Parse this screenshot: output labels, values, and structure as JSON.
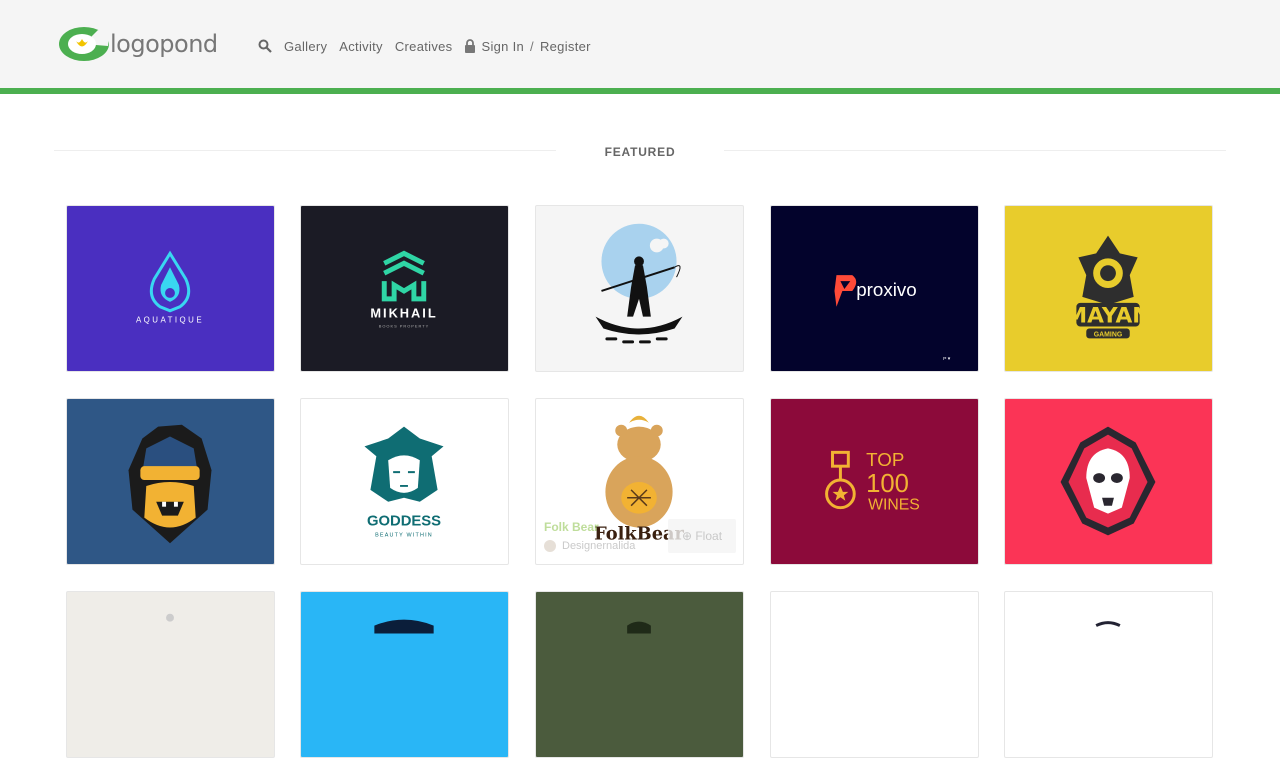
{
  "header": {
    "logo_text": "logopond",
    "nav": {
      "gallery": "Gallery",
      "activity": "Activity",
      "creatives": "Creatives",
      "sign_in": "Sign In",
      "separator": "/",
      "register": "Register"
    },
    "accent_color": "#4caf50"
  },
  "section": {
    "title": "FEATURED"
  },
  "tiles": [
    {
      "name": "Aquatique",
      "text": "AQUATIQUE",
      "bg": "#4a2fc0"
    },
    {
      "name": "Mikhail",
      "text": "MIKHAIL",
      "subtext": "BOOKS PROPERTY",
      "bg": "#1b1b25"
    },
    {
      "name": "Fisherman",
      "bg": "#f5f5f5"
    },
    {
      "name": "Proxivo",
      "text": "proxivo",
      "bg": "#03032c"
    },
    {
      "name": "Mayan Gaming",
      "text": "MAYAN",
      "subtext": "GAMING",
      "bg": "#e8cc2c"
    },
    {
      "name": "Gorilla",
      "bg": "#2f5786"
    },
    {
      "name": "Goddess",
      "text": "GODDESS",
      "subtext": "BEAUTY WITHIN",
      "bg": "#ffffff"
    },
    {
      "name": "Folk Bear",
      "text": "FolkBear",
      "bg": "#ffffff",
      "hover": {
        "title": "Folk Bear",
        "user": "Designernalida",
        "action": "Float"
      }
    },
    {
      "name": "Top 100 Wines",
      "lines": [
        "TOP",
        "100",
        "WINES"
      ],
      "bg": "#8c0a3a"
    },
    {
      "name": "Reaper",
      "bg": "#fb3456"
    },
    {
      "name": "Row3-1",
      "bg": "#efede8"
    },
    {
      "name": "Row3-2",
      "bg": "#29b6f6"
    },
    {
      "name": "Row3-3",
      "bg": "#4b5b3d"
    },
    {
      "name": "Row3-4",
      "bg": "#ffffff"
    },
    {
      "name": "Row3-5",
      "bg": "#ffffff"
    }
  ]
}
